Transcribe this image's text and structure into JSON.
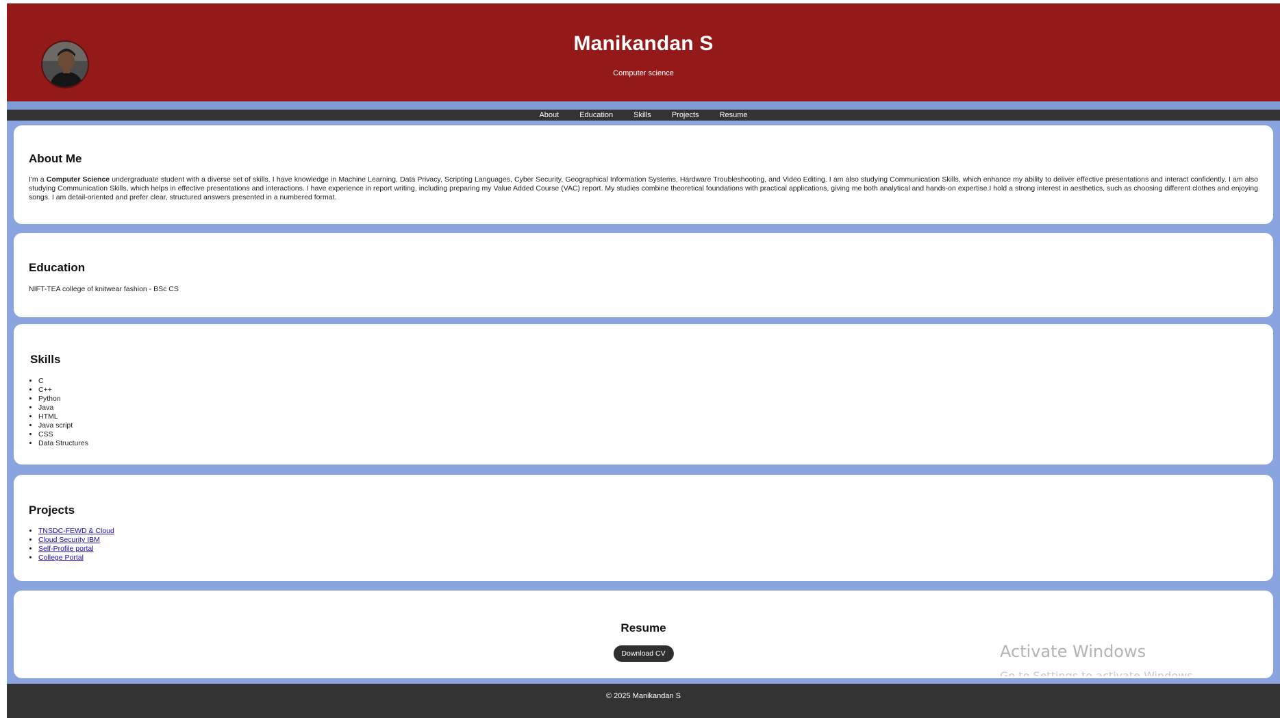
{
  "header": {
    "name": "Manikandan S",
    "subtitle": "Computer science",
    "background_color": "#941a1a"
  },
  "nav": {
    "items": [
      {
        "label": "About"
      },
      {
        "label": "Education"
      },
      {
        "label": "Skills"
      },
      {
        "label": "Projects"
      },
      {
        "label": "Resume"
      }
    ]
  },
  "about": {
    "heading": "About Me",
    "intro": "I'm a ",
    "highlight": "Computer Science",
    "body": " undergraduate student with a diverse set of skills. I have knowledge in Machine Learning, Data Privacy, Scripting Languages, Cyber Security, Geographical Information Systems, Hardware Troubleshooting, and Video Editing. I am also studying Communication Skills, which enhance my ability to deliver effective presentations and interact confidently. I am also studying Communication Skills, which helps in effective presentations and interactions. I have experience in report writing, including preparing my Value Added Course (VAC) report. My studies combine theoretical foundations with practical applications, giving me both analytical and hands-on expertise.I hold a strong interest in aesthetics, such as choosing different clothes and enjoying songs. I am detail-oriented and prefer clear, structured answers presented in a numbered format."
  },
  "education": {
    "heading": "Education",
    "entry": "NIFT-TEA college of knitwear fashion - BSc CS"
  },
  "skills": {
    "heading": "Skills",
    "items": [
      "C",
      "C++",
      "Python",
      "Java",
      "HTML",
      "Java script",
      "CSS",
      "Data Structures"
    ]
  },
  "projects": {
    "heading": "Projects",
    "items": [
      "TNSDC-FEWD & Cloud",
      "Cloud Security IBM",
      "Self-Profile portal",
      "College Portal"
    ]
  },
  "resume": {
    "heading": "Resume",
    "button_label": "Download CV"
  },
  "watermark": {
    "title": "Activate Windows",
    "subtitle": "Go to Settings to activate Windows."
  },
  "footer": {
    "text": "© 2025 Manikandan S"
  },
  "colors": {
    "page_background": "#8aa4e0",
    "nav_background": "#333333",
    "footer_background": "#333333",
    "link": "#1a0dab"
  }
}
